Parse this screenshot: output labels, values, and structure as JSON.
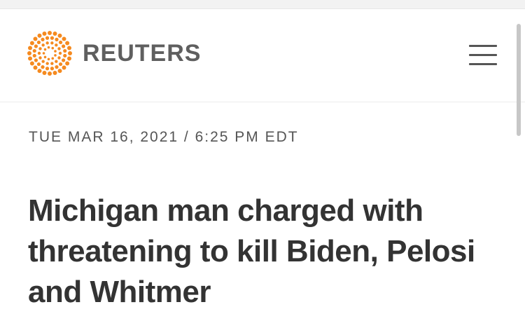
{
  "header": {
    "logo_text": "REUTERS",
    "logo_icon": "reuters-dot-ring-icon",
    "menu_icon": "hamburger-menu-icon"
  },
  "article": {
    "dateline": "TUE MAR 16, 2021 / 6:25 PM EDT",
    "headline": "Michigan man charged with threatening to kill Biden, Pelosi and Whitmer"
  },
  "colors": {
    "brand_orange": "#f58a1f",
    "logo_text": "#5f5f5f",
    "headline_text": "#333333",
    "dateline_text": "#555555"
  }
}
